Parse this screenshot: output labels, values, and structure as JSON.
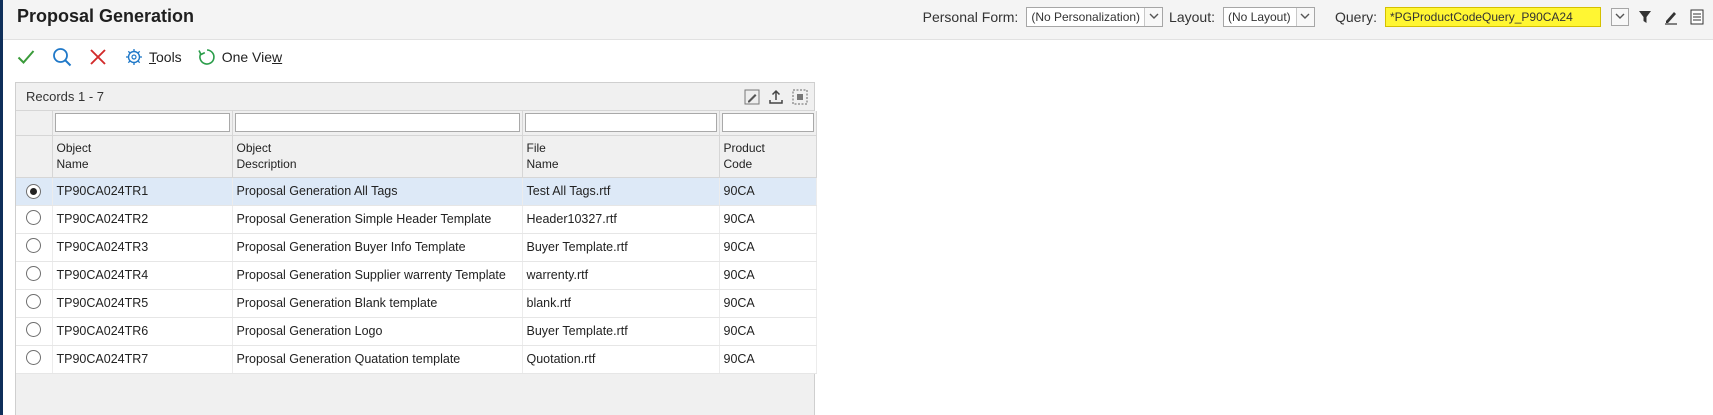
{
  "header": {
    "title": "Proposal Generation",
    "personal_form_label": "Personal Form:",
    "personal_form_value": "(No Personalization)",
    "layout_label": "Layout:",
    "layout_value": "(No Layout)",
    "query_label": "Query:",
    "query_value": "*PGProductCodeQuery_P90CA24",
    "query_highlight_color": "#fff633"
  },
  "toolbar": {
    "ok_icon": "check-icon",
    "find_icon": "search-icon",
    "cancel_icon": "close-icon",
    "tools_label": "Tools",
    "tools_underline": "T",
    "tools_rest": "ools",
    "one_view_label": "One View",
    "one_view_prefix": "One Vie",
    "one_view_underline": "w"
  },
  "grid": {
    "records_label": "Records 1 - 7",
    "columns": [
      {
        "line1": "Object",
        "line2": "Name"
      },
      {
        "line1": "Object",
        "line2": "Description"
      },
      {
        "line1": "File",
        "line2": "Name"
      },
      {
        "line1": "Product",
        "line2": "Code"
      }
    ],
    "rows": [
      {
        "object_name": "TP90CA024TR1",
        "description": "Proposal Generation All Tags",
        "file_name": "Test All Tags.rtf",
        "product_code": "90CA",
        "selected": true
      },
      {
        "object_name": "TP90CA024TR2",
        "description": "Proposal Generation Simple Header Template",
        "file_name": "Header10327.rtf",
        "product_code": "90CA",
        "selected": false
      },
      {
        "object_name": "TP90CA024TR3",
        "description": "Proposal Generation Buyer Info Template",
        "file_name": "Buyer Template.rtf",
        "product_code": "90CA",
        "selected": false
      },
      {
        "object_name": "TP90CA024TR4",
        "description": "Proposal Generation Supplier warrenty Template",
        "file_name": "warrenty.rtf",
        "product_code": "90CA",
        "selected": false
      },
      {
        "object_name": "TP90CA024TR5",
        "description": "Proposal Generation Blank template",
        "file_name": "blank.rtf",
        "product_code": "90CA",
        "selected": false
      },
      {
        "object_name": "TP90CA024TR6",
        "description": "Proposal Generation Logo",
        "file_name": "Buyer Template.rtf",
        "product_code": "90CA",
        "selected": false
      },
      {
        "object_name": "TP90CA024TR7",
        "description": "Proposal Generation Quatation template",
        "file_name": "Quotation.rtf",
        "product_code": "90CA",
        "selected": false
      }
    ]
  }
}
